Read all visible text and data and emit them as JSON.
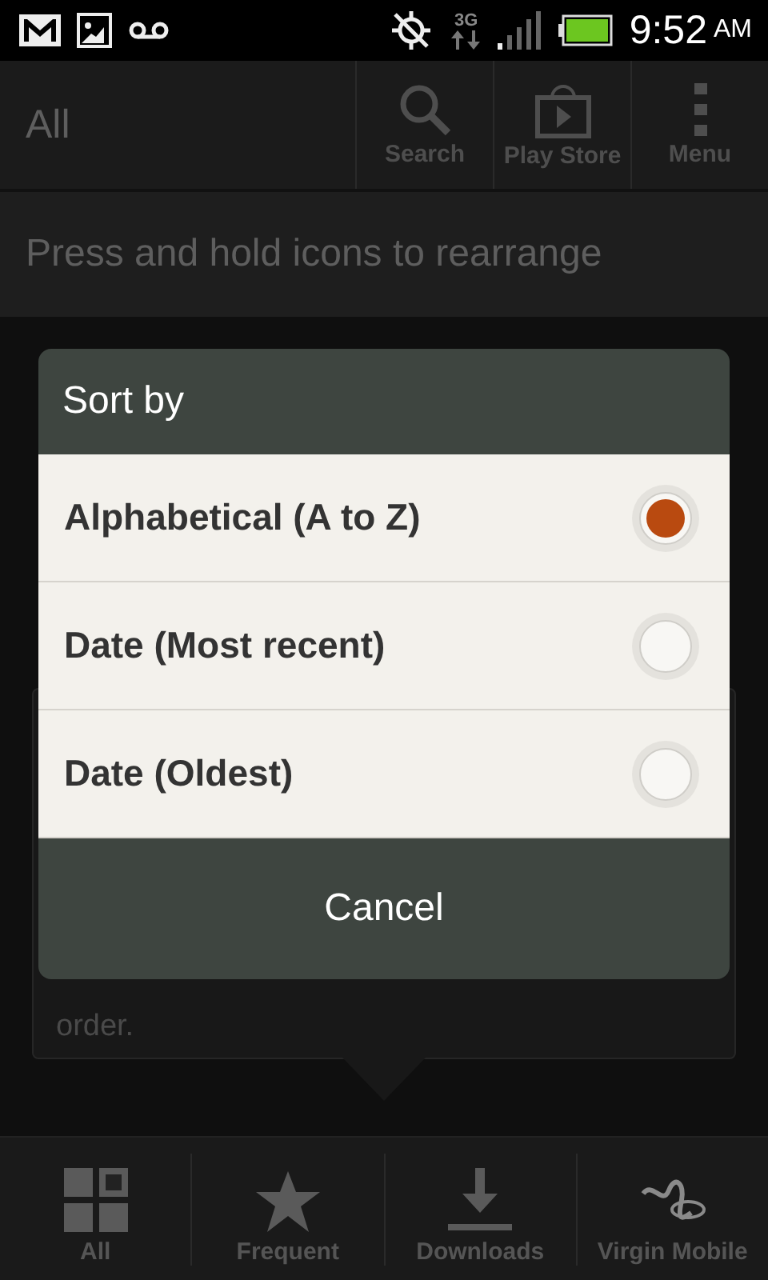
{
  "status_bar": {
    "time": "9:52",
    "meridiem": "AM",
    "network": "3G"
  },
  "action_bar": {
    "title": "All",
    "actions": [
      {
        "label": "Search",
        "kind": "search"
      },
      {
        "label": "Play Store",
        "kind": "store"
      },
      {
        "label": "Menu",
        "kind": "menu"
      }
    ]
  },
  "hint": "Press and hold icons to rearrange",
  "tooltip": {
    "lines": [
      "order."
    ]
  },
  "dialog": {
    "title": "Sort by",
    "options": [
      {
        "label": "Alphabetical (A to Z)",
        "selected": true
      },
      {
        "label": "Date (Most recent)",
        "selected": false
      },
      {
        "label": "Date (Oldest)",
        "selected": false
      }
    ],
    "cancel": "Cancel"
  },
  "bottom_nav": [
    {
      "label": "All",
      "kind": "grid"
    },
    {
      "label": "Frequent",
      "kind": "star"
    },
    {
      "label": "Downloads",
      "kind": "download"
    },
    {
      "label": "Virgin Mobile",
      "kind": "brand"
    }
  ]
}
